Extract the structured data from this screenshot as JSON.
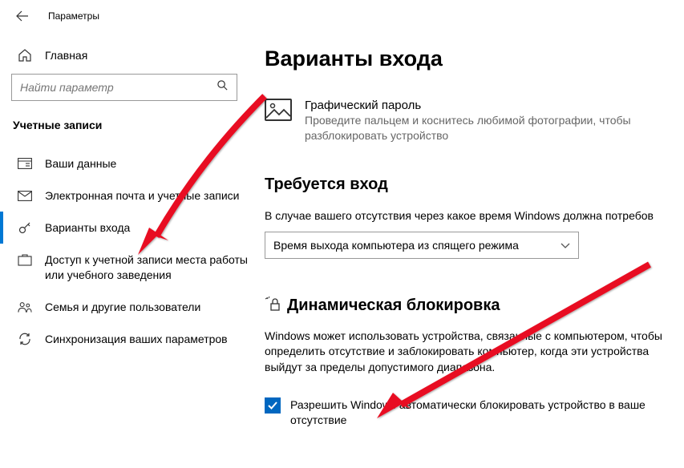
{
  "titlebar": {
    "title": "Параметры"
  },
  "sidebar": {
    "home": "Главная",
    "search_placeholder": "Найти параметр",
    "category": "Учетные записи",
    "items": [
      {
        "label": "Ваши данные"
      },
      {
        "label": "Электронная почта и учетные записи"
      },
      {
        "label": "Варианты входа"
      },
      {
        "label": "Доступ к учетной записи места работы или учебного заведения"
      },
      {
        "label": "Семья и другие пользователи"
      },
      {
        "label": "Синхронизация ваших параметров"
      }
    ]
  },
  "main": {
    "heading": "Варианты входа",
    "picture_password": {
      "title": "Графический пароль",
      "subtitle": "Проведите пальцем и коснитесь любимой фотографии, чтобы разблокировать устройство"
    },
    "require_signin": {
      "title": "Требуется вход",
      "desc": "В случае вашего отсутствия через какое время Windows должна потребов",
      "select_value": "Время выхода компьютера из спящего режима"
    },
    "dynamic_lock": {
      "title": "Динамическая блокировка",
      "desc": "Windows может использовать устройства, связанные с компьютером, чтобы определить отсутствие и заблокировать компьютер, когда эти устройства выйдут за пределы допустимого диапазона.",
      "checkbox_label": "Разрешить Windows автоматически блокировать устройство в ваше отсутствие"
    }
  }
}
